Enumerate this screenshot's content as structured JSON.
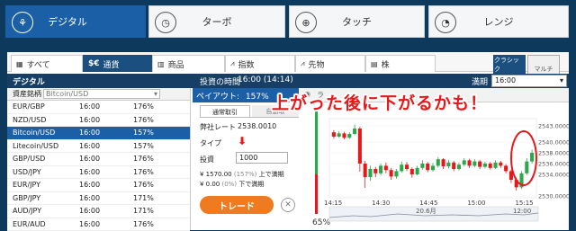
{
  "top_tabs": [
    {
      "label": "デジタル",
      "active": true,
      "icon": "tree-icon"
    },
    {
      "label": "ターボ",
      "active": false,
      "icon": "clock-icon"
    },
    {
      "label": "タッチ",
      "active": false,
      "icon": "target-icon"
    },
    {
      "label": "レンジ",
      "active": false,
      "icon": "gauge-icon"
    }
  ],
  "asset_tabs": [
    {
      "label": "すべて",
      "active": false
    },
    {
      "label": "通貨",
      "active": true,
      "prefix": "$€"
    },
    {
      "label": "商品",
      "active": false
    },
    {
      "label": "指数",
      "active": false
    },
    {
      "label": "先物",
      "active": false
    },
    {
      "label": "株",
      "active": false
    }
  ],
  "mode_buttons": {
    "classic": "クラシック",
    "multi": "マルチ"
  },
  "header": {
    "title": "デジタル",
    "time_label": "投資の時間",
    "time_value": "16:00 (14:14)",
    "expiry_label": "満期",
    "expiry_value": "16:00"
  },
  "asset_list": {
    "header_label": "資産銘柄",
    "filter_value": "Bitcoin/USD",
    "rows": [
      {
        "name": "EUR/GBP",
        "time": "16:00",
        "payout": "176%"
      },
      {
        "name": "NZD/USD",
        "time": "16:00",
        "payout": "176%"
      },
      {
        "name": "Bitcoin/USD",
        "time": "16:00",
        "payout": "157%",
        "selected": true
      },
      {
        "name": "Litecoin/USD",
        "time": "16:00",
        "payout": "157%"
      },
      {
        "name": "GBP/USD",
        "time": "16:00",
        "payout": "176%"
      },
      {
        "name": "USD/JPY",
        "time": "16:00",
        "payout": "176%"
      },
      {
        "name": "EUR/JPY",
        "time": "16:00",
        "payout": "176%"
      },
      {
        "name": "GBP/JPY",
        "time": "16:00",
        "payout": "171%"
      },
      {
        "name": "AUD/JPY",
        "time": "16:00",
        "payout": "171%"
      },
      {
        "name": "EUR/AUD",
        "time": "16:00",
        "payout": "176%"
      }
    ]
  },
  "trade_panel": {
    "payout_label": "ペイアウト:",
    "payout_value": "157%",
    "tab_normal": "通常取引",
    "tab_auto": "自動取",
    "rate_label": "弊社レート",
    "rate_value": "2538.0010",
    "type_label": "タイプ",
    "invest_label": "投資",
    "invest_value": "1000",
    "up_result": "¥ 1570.00",
    "up_pct": "(157%)",
    "up_text": "上で満期",
    "down_result": "¥ 0.00",
    "down_pct": "(0%)",
    "down_text": "下で満期",
    "trade_button": "トレード"
  },
  "chart_panel": {
    "percent_label": "65%",
    "partial_label": "ラ",
    "annotation": "上がった後に下がるかも！",
    "date_label": "20.6月",
    "zoom_time": "12:00"
  },
  "colors": {
    "accent": "#1b5fa6",
    "header": "#173f66",
    "up": "#2aa84a",
    "down": "#e8181a",
    "trade": "#f07a20"
  },
  "chart_data": {
    "type": "candlestick",
    "x_ticks": [
      "14:15",
      "14:30",
      "14:45",
      "15:00",
      "15:15"
    ],
    "y_ticks": [
      "2543.0000",
      "2540.0000",
      "2538.0000",
      "2536.0000",
      "2534.0000",
      "2530.0000"
    ],
    "ylim": [
      2530,
      2544
    ],
    "candles": [
      {
        "o": 2541.8,
        "c": 2541.0,
        "h": 2542.2,
        "l": 2540.6
      },
      {
        "o": 2541.0,
        "c": 2541.6,
        "h": 2542.0,
        "l": 2540.8
      },
      {
        "o": 2541.6,
        "c": 2540.8,
        "h": 2541.9,
        "l": 2540.5
      },
      {
        "o": 2540.8,
        "c": 2541.5,
        "h": 2541.8,
        "l": 2540.6
      },
      {
        "o": 2541.5,
        "c": 2542.5,
        "h": 2543.2,
        "l": 2541.3
      },
      {
        "o": 2542.5,
        "c": 2536.0,
        "h": 2542.8,
        "l": 2534.5
      },
      {
        "o": 2536.0,
        "c": 2533.5,
        "h": 2536.5,
        "l": 2531.5
      },
      {
        "o": 2533.5,
        "c": 2535.0,
        "h": 2535.6,
        "l": 2532.8
      },
      {
        "o": 2535.0,
        "c": 2534.2,
        "h": 2535.4,
        "l": 2533.5
      },
      {
        "o": 2534.2,
        "c": 2535.6,
        "h": 2536.0,
        "l": 2533.8
      },
      {
        "o": 2535.6,
        "c": 2534.8,
        "h": 2536.2,
        "l": 2534.2
      },
      {
        "o": 2534.8,
        "c": 2533.6,
        "h": 2535.2,
        "l": 2533.0
      },
      {
        "o": 2533.6,
        "c": 2534.6,
        "h": 2535.0,
        "l": 2533.2
      },
      {
        "o": 2534.6,
        "c": 2535.8,
        "h": 2536.4,
        "l": 2534.3
      },
      {
        "o": 2535.8,
        "c": 2535.0,
        "h": 2536.3,
        "l": 2534.6
      },
      {
        "o": 2535.0,
        "c": 2534.0,
        "h": 2535.3,
        "l": 2533.4
      },
      {
        "o": 2534.0,
        "c": 2535.2,
        "h": 2535.6,
        "l": 2533.8
      },
      {
        "o": 2535.2,
        "c": 2536.0,
        "h": 2536.6,
        "l": 2534.9
      },
      {
        "o": 2536.0,
        "c": 2534.8,
        "h": 2536.3,
        "l": 2534.4
      },
      {
        "o": 2534.8,
        "c": 2535.6,
        "h": 2536.1,
        "l": 2534.5
      },
      {
        "o": 2535.6,
        "c": 2536.8,
        "h": 2537.2,
        "l": 2535.3
      },
      {
        "o": 2536.8,
        "c": 2535.5,
        "h": 2537.0,
        "l": 2535.0
      },
      {
        "o": 2535.5,
        "c": 2536.2,
        "h": 2536.7,
        "l": 2535.1
      },
      {
        "o": 2536.2,
        "c": 2535.0,
        "h": 2536.5,
        "l": 2534.6
      },
      {
        "o": 2535.0,
        "c": 2535.8,
        "h": 2536.2,
        "l": 2534.7
      },
      {
        "o": 2535.8,
        "c": 2536.6,
        "h": 2537.0,
        "l": 2535.5
      },
      {
        "o": 2536.6,
        "c": 2535.6,
        "h": 2536.9,
        "l": 2535.2
      },
      {
        "o": 2535.6,
        "c": 2536.4,
        "h": 2536.8,
        "l": 2535.3
      },
      {
        "o": 2536.4,
        "c": 2535.4,
        "h": 2536.7,
        "l": 2535.0
      },
      {
        "o": 2535.4,
        "c": 2536.0,
        "h": 2536.4,
        "l": 2535.1
      },
      {
        "o": 2536.0,
        "c": 2535.2,
        "h": 2536.3,
        "l": 2534.9
      },
      {
        "o": 2535.2,
        "c": 2536.2,
        "h": 2536.6,
        "l": 2535.0
      },
      {
        "o": 2536.2,
        "c": 2535.6,
        "h": 2536.5,
        "l": 2535.2
      },
      {
        "o": 2535.6,
        "c": 2534.6,
        "h": 2535.9,
        "l": 2534.2
      },
      {
        "o": 2534.6,
        "c": 2533.0,
        "h": 2534.9,
        "l": 2532.4
      },
      {
        "o": 2533.0,
        "c": 2531.6,
        "h": 2533.4,
        "l": 2531.0
      },
      {
        "o": 2531.6,
        "c": 2534.2,
        "h": 2534.6,
        "l": 2531.3
      },
      {
        "o": 2534.2,
        "c": 2536.4,
        "h": 2537.0,
        "l": 2533.9
      },
      {
        "o": 2536.4,
        "c": 2538.0,
        "h": 2538.6,
        "l": 2536.0
      }
    ]
  }
}
